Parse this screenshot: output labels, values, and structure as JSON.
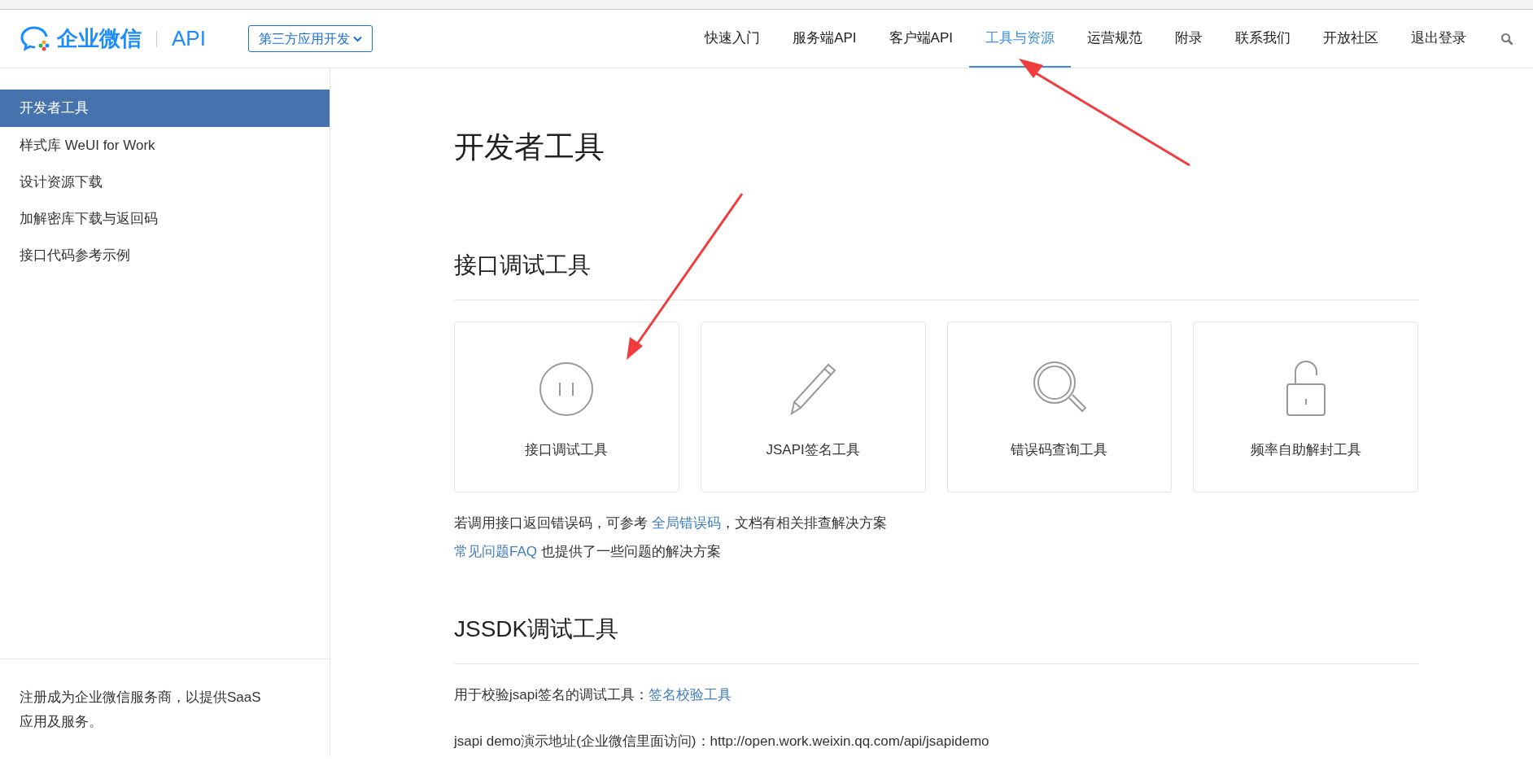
{
  "header": {
    "logo_text": "企业微信",
    "product": "API",
    "dropdown": "第三方应用开发",
    "nav": [
      {
        "label": "快速入门",
        "selected": false
      },
      {
        "label": "服务端API",
        "selected": false
      },
      {
        "label": "客户端API",
        "selected": false
      },
      {
        "label": "工具与资源",
        "selected": true
      },
      {
        "label": "运营规范",
        "selected": false
      },
      {
        "label": "附录",
        "selected": false
      },
      {
        "label": "联系我们",
        "selected": false
      },
      {
        "label": "开放社区",
        "selected": false
      },
      {
        "label": "退出登录",
        "selected": false
      }
    ]
  },
  "sidebar": {
    "items": [
      {
        "label": "开发者工具",
        "selected": true
      },
      {
        "label": "样式库 WeUI for Work",
        "selected": false
      },
      {
        "label": "设计资源下载",
        "selected": false
      },
      {
        "label": "加解密库下载与返回码",
        "selected": false
      },
      {
        "label": "接口代码参考示例",
        "selected": false
      }
    ],
    "footer": "注册成为企业微信服务商，以提供SaaS应用及服务。"
  },
  "content": {
    "title": "开发者工具",
    "sections": [
      {
        "heading": "接口调试工具",
        "cards": [
          {
            "kind": "plug",
            "label": "接口调试工具"
          },
          {
            "kind": "pencil",
            "label": "JSAPI签名工具"
          },
          {
            "kind": "magnifier",
            "label": "错误码查询工具"
          },
          {
            "kind": "lock",
            "label": "频率自助解封工具"
          }
        ],
        "paragraphs": [
          {
            "before": "若调用接口返回错误码，可参考 ",
            "link": "全局错误码",
            "after": "，文档有相关排查解决方案"
          },
          {
            "link": "常见问题FAQ",
            "after": " 也提供了一些问题的解决方案"
          }
        ]
      },
      {
        "heading": "JSSDK调试工具",
        "paragraphs": [
          {
            "before": "用于校验jsapi签名的调试工具：",
            "link": "签名校验工具"
          },
          {
            "before": "jsapi demo演示地址(企业微信里面访问)：http://open.work.weixin.qq.com/api/jsapidemo"
          }
        ]
      }
    ]
  }
}
